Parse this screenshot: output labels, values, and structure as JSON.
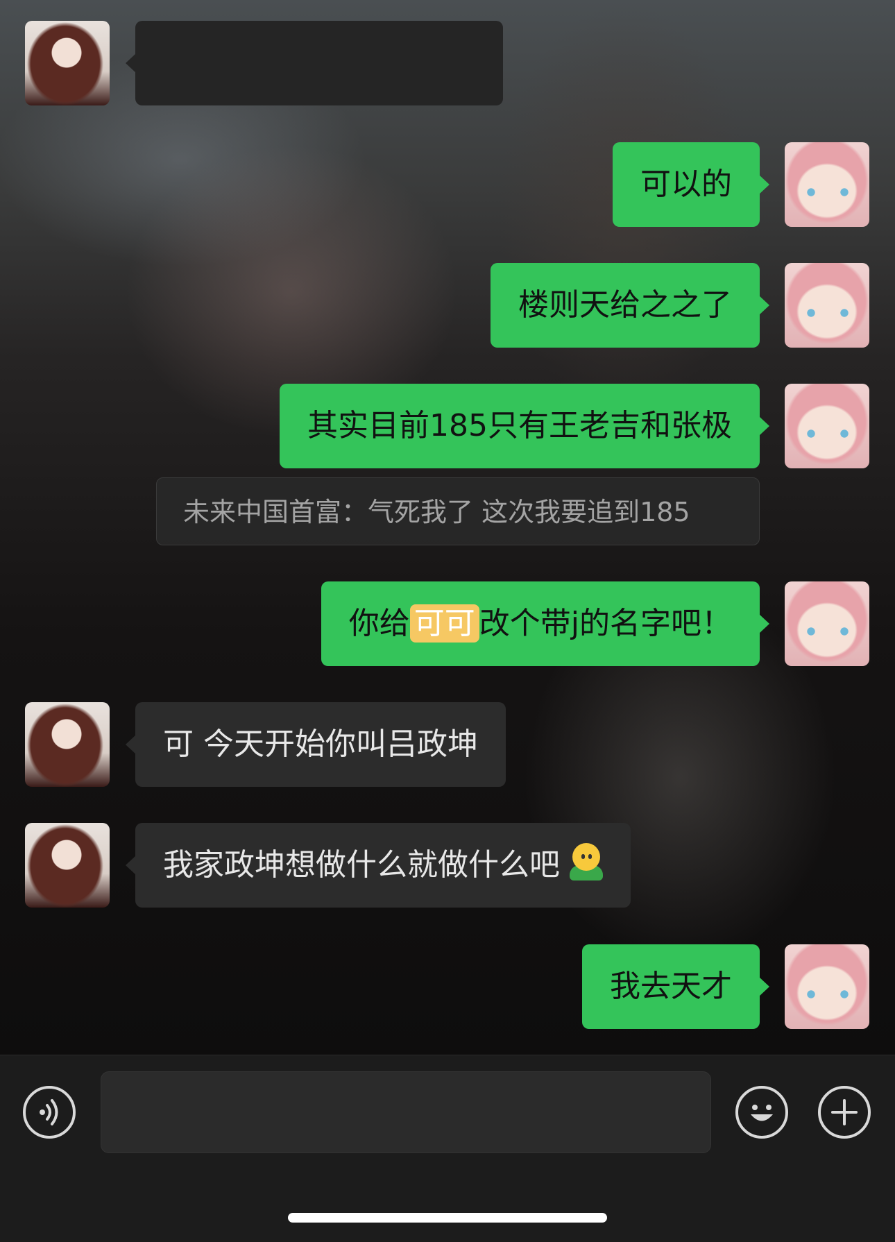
{
  "messages": {
    "m1": {
      "text": "可以的"
    },
    "m2": {
      "text": "楼则天给之之了"
    },
    "m3": {
      "text": "其实目前185只有王老吉和张极"
    },
    "quote": {
      "text": "未来中国首富：气死我了 这次我要追到185"
    },
    "m4": {
      "before": "你给",
      "highlight": "可可",
      "after": "改个带j的名字吧！"
    },
    "m5": {
      "text": "可 今天开始你叫吕政坤"
    },
    "m6": {
      "text": "我家政坤想做什么就做什么吧"
    },
    "m7": {
      "text": "我去天才"
    }
  },
  "input_bar": {
    "placeholder": "",
    "voice_icon": "voice-icon",
    "emoji_icon": "emoji-icon",
    "plus_icon": "plus-icon"
  },
  "colors": {
    "mine_bubble": "#34c45a",
    "theirs_bubble": "#2c2c2c",
    "highlight": "#f6c863"
  }
}
